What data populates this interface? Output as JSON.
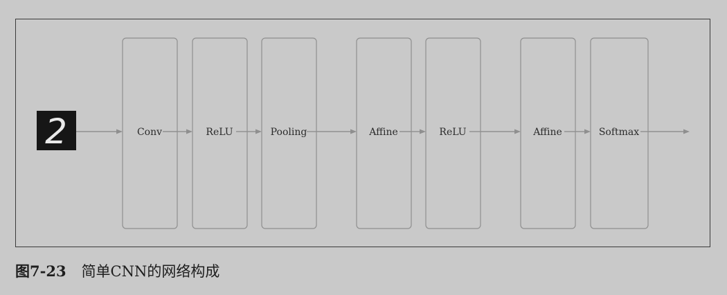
{
  "input_image": {
    "digit": "2"
  },
  "layers": [
    {
      "label": "Conv"
    },
    {
      "label": "ReLU"
    },
    {
      "label": "Pooling"
    },
    {
      "label": "Affine"
    },
    {
      "label": "ReLU"
    },
    {
      "label": "Affine"
    },
    {
      "label": "Softmax"
    }
  ],
  "caption": {
    "number": "图7-23",
    "text": "简单CNN的网络构成"
  }
}
